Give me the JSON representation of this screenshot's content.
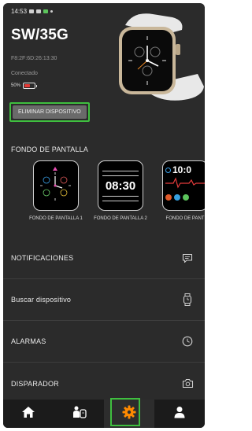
{
  "status_bar": {
    "time": "14:53"
  },
  "device": {
    "model": "SW/35G",
    "mac": "F8:2F:6D:26:13:30",
    "connection_status": "Conectado",
    "battery_text": "50%",
    "battery_level": 0.5,
    "remove_button": "ELIMINAR DISPOSITIVO"
  },
  "wallpaper": {
    "title": "FONDO DE PANTALLA",
    "faces": [
      {
        "label": "FONDO DE PANTALLA 1"
      },
      {
        "label": "FONDO DE PANTALLA 2",
        "time": "08:30"
      },
      {
        "label": "FONDO DE PANT",
        "time": "10:0"
      }
    ]
  },
  "menu": [
    {
      "label": "NOTIFICACIONES",
      "icon": "chat-icon"
    },
    {
      "label": "Buscar dispositivo",
      "icon": "watch-icon"
    },
    {
      "label": "ALARMAS",
      "icon": "clock-icon"
    },
    {
      "label": "DISPARADOR",
      "icon": "camera-icon"
    }
  ],
  "tabbar": {
    "tabs": [
      {
        "icon": "home-icon"
      },
      {
        "icon": "activity-icon"
      },
      {
        "icon": "gear-icon",
        "active": true
      },
      {
        "icon": "user-icon"
      }
    ]
  },
  "colors": {
    "accent": "#ff8a00",
    "highlight": "#3fbf3f",
    "background": "#2b2b2b"
  }
}
